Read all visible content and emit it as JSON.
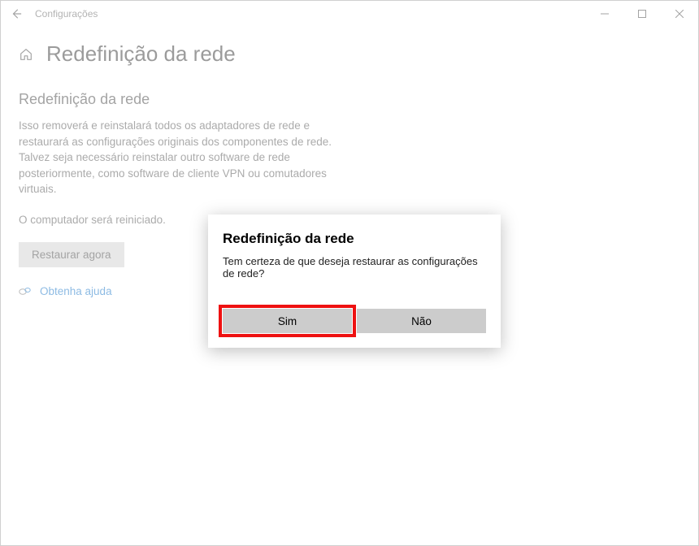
{
  "titlebar": {
    "app_name": "Configurações"
  },
  "page": {
    "title": "Redefinição da rede",
    "section_title": "Redefinição da rede",
    "section_body": "Isso removerá e reinstalará todos os adaptadores de rede e restaurará as configurações originais dos componentes de rede. Talvez seja necessário reinstalar outro software de rede posteriormente, como software de cliente VPN ou comutadores virtuais.",
    "restart_note": "O computador será reiniciado.",
    "reset_button": "Restaurar agora",
    "help_link": "Obtenha ajuda"
  },
  "dialog": {
    "title": "Redefinição da rede",
    "message": "Tem certeza de que deseja restaurar as configurações de rede?",
    "yes": "Sim",
    "no": "Não"
  }
}
